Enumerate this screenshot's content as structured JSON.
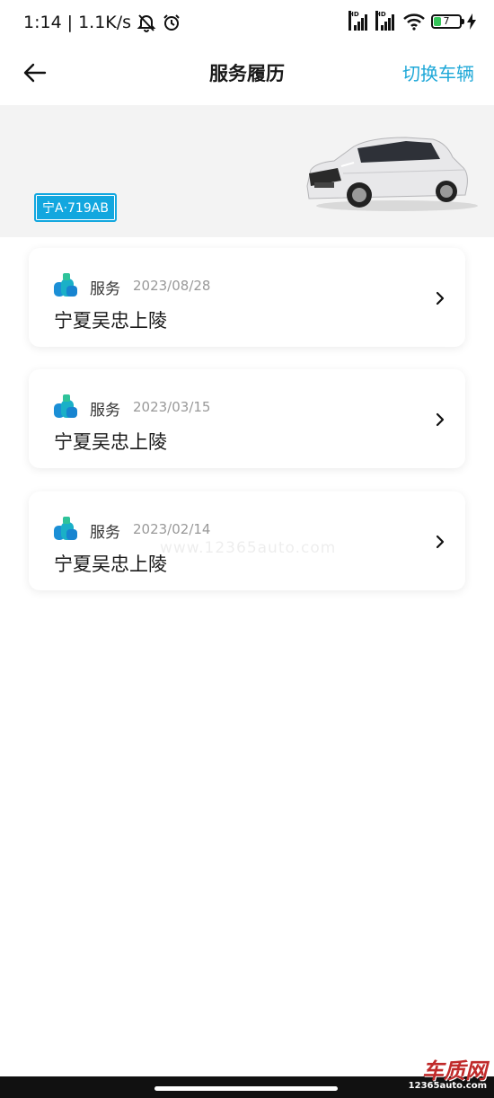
{
  "status": {
    "time": "1:14",
    "speed": "1.1K/s",
    "battery": "7",
    "hd1": "HD",
    "hd2": "HD"
  },
  "header": {
    "title": "服务履历",
    "switch_label": "切换车辆"
  },
  "vehicle": {
    "plate": "宁A·719AB"
  },
  "records": [
    {
      "type": "服务",
      "date": "2023/08/28",
      "dealer": "宁夏吴忠上陵"
    },
    {
      "type": "服务",
      "date": "2023/03/15",
      "dealer": "宁夏吴忠上陵"
    },
    {
      "type": "服务",
      "date": "2023/02/14",
      "dealer": "宁夏吴忠上陵"
    }
  ],
  "watermark": "www.12365auto.com",
  "logo": {
    "mark": "车质网",
    "url": "12365auto.com"
  },
  "colors": {
    "accent": "#1fa8d8",
    "plate_bg": "#12a7df",
    "banner_bg": "#f3f3f3"
  }
}
